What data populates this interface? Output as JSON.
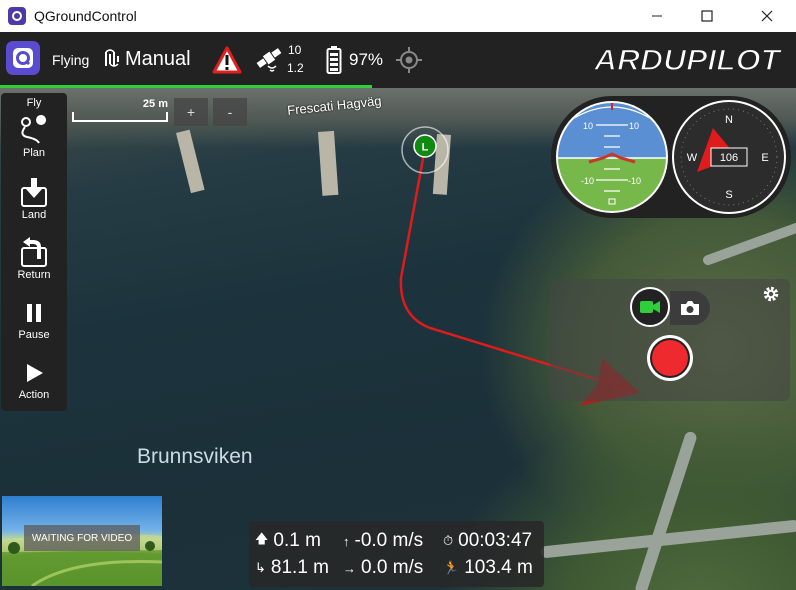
{
  "window": {
    "title": "QGroundControl"
  },
  "toolbar": {
    "flight_state": "Flying",
    "flight_mode": "Manual",
    "gps_sats": "10",
    "gps_hdop": "1.2",
    "battery": "97%",
    "brand": "ARDUPILOT"
  },
  "map": {
    "scale_label": "25 m",
    "zoom_in": "+",
    "zoom_out": "-",
    "road_label": "Frescati Hagväg",
    "water_label": "Brunnsviken",
    "vehicle_marker": "L"
  },
  "toolstrip": {
    "items": [
      {
        "label": "Fly"
      },
      {
        "label": "Plan"
      },
      {
        "label": "Land"
      },
      {
        "label": "Return"
      },
      {
        "label": "Pause"
      },
      {
        "label": "Action"
      }
    ]
  },
  "attitude": {
    "pitch_up_left": "10",
    "pitch_up_right": "10",
    "pitch_down_left": "-10",
    "pitch_down_right": "-10"
  },
  "compass": {
    "heading": "106",
    "n": "N",
    "e": "E",
    "s": "S",
    "w": "W"
  },
  "video": {
    "status": "WAITING FOR VIDEO"
  },
  "telemetry": {
    "altitude": "0.1 m",
    "vertical_speed": "-0.0 m/s",
    "flight_time": "00:03:47",
    "distance_home": "81.1 m",
    "ground_speed": "0.0 m/s",
    "distance_travelled": "103.4 m"
  },
  "colors": {
    "accent_green": "#2fce3a",
    "qgc_purple": "#5a4bd0",
    "record_red": "#ee2a2f",
    "path_red": "#e01b1b"
  }
}
